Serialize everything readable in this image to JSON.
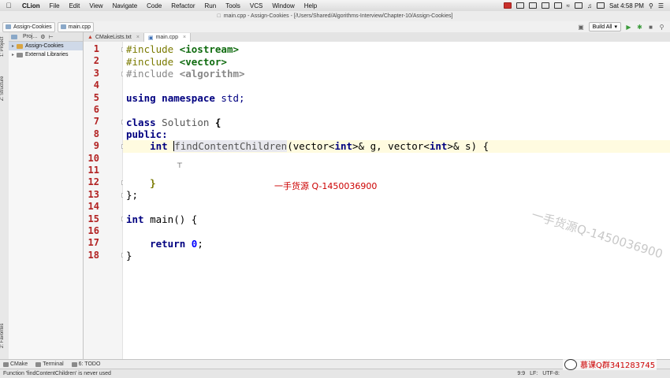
{
  "menubar": {
    "app_name": "CLion",
    "items": [
      "File",
      "Edit",
      "View",
      "Navigate",
      "Code",
      "Refactor",
      "Run",
      "Tools",
      "VCS",
      "Window",
      "Help"
    ],
    "clock": "Sat 4:58 PM"
  },
  "window": {
    "title": "main.cpp - Assign-Cookies - [/Users/Shared/Algorithms-Interview/Chapter-10/Assign-Cookies]"
  },
  "toolbar": {
    "breadcrumb_project": "Assign-Cookies",
    "breadcrumb_file": "main.cpp",
    "run_config": "Build All"
  },
  "left_strip": {
    "project_tab": "1: Project",
    "structure_tab": "Z: Structure",
    "favorites_tab": "2: Favorites"
  },
  "project_pane": {
    "header": "Proj...",
    "tree": [
      {
        "label": "Assign-Cookies",
        "selected": true,
        "kind": "folder"
      },
      {
        "label": "External Libraries",
        "selected": false,
        "kind": "library"
      }
    ]
  },
  "editor_tabs": [
    {
      "label": "CMakeLists.txt",
      "active": false
    },
    {
      "label": "main.cpp",
      "active": true
    }
  ],
  "code": {
    "line_numbers": [
      "1",
      "2",
      "3",
      "4",
      "5",
      "6",
      "7",
      "8",
      "9",
      "10",
      "11",
      "12",
      "13",
      "14",
      "15",
      "16",
      "17",
      "18"
    ],
    "l1_dir": "#include ",
    "l1_hdr": "<iostream>",
    "l2_dir": "#include ",
    "l2_hdr": "<vector>",
    "l3_dir": "#include ",
    "l3_hdr": "<algorithm>",
    "l5_kw1": "using",
    "l5_kw2": "namespace",
    "l5_rest": " std;",
    "l7_kw": "class",
    "l7_name": " Solution",
    "l7_rest": " {",
    "l8_kw": "public:",
    "l9_indent": "    ",
    "l9_type": "int",
    "l9_sp": " ",
    "l9_fn": "findContentChildren",
    "l9_p1": "(vector<",
    "l9_t1": "int",
    "l9_p2": ">& g, vector<",
    "l9_t2": "int",
    "l9_p3": ">& s) {",
    "l12_brace": "    }",
    "l13": "};",
    "l15_type": "int",
    "l15_rest": " main() {",
    "l17_indent": "    ",
    "l17_kw": "return",
    "l17_sp": " ",
    "l17_num": "0",
    "l17_end": ";",
    "l18": "}"
  },
  "watermarks": {
    "center": "一手货源 Q-1450036900",
    "diagonal": "一手货源Q-1450036900",
    "logo": "慕课Q群341283745"
  },
  "bottom_tools": [
    "CMake",
    "Terminal",
    "6: TODO"
  ],
  "status": {
    "message": "Function 'findContentChildren' is never used",
    "position": "9:9",
    "line_sep": "LF:",
    "encoding": "UTF-8:"
  }
}
